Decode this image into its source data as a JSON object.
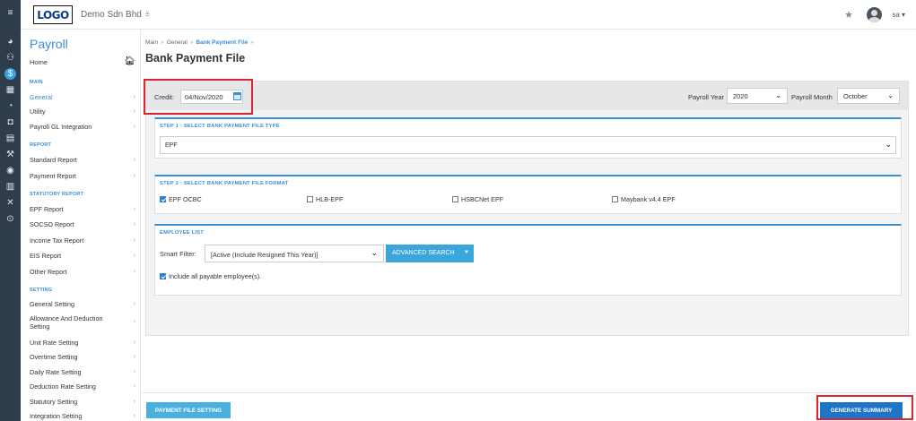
{
  "header": {
    "logo_text": "LOGO",
    "company": "Demo Sdn Bhd",
    "company_chevron": "≚",
    "favorite_icon": "★",
    "user": "sa ▾"
  },
  "rail": {
    "icons": [
      "≡",
      "◕",
      "⚇",
      "$",
      "▦",
      "◔",
      "◘",
      "▤",
      "⚒",
      "◉",
      "▥",
      "✕",
      "⊙"
    ]
  },
  "sidebar": {
    "title": "Payroll",
    "home": "Home",
    "sections": {
      "main": "MAIN",
      "report": "REPORT",
      "statutory": "STATUTORY REPORT",
      "setting": "SETTING"
    },
    "main_items": [
      "General",
      "Utility",
      "Payroll GL Integration"
    ],
    "report_items": [
      "Standard Report",
      "Payment Report"
    ],
    "statutory_items": [
      "EPF Report",
      "SOCSO Report",
      "Income Tax Report",
      "EIS Report",
      "Other Report"
    ],
    "setting_items": [
      "General Setting",
      "Allowance And Deduction Setting",
      "Unit Rate Setting",
      "Overtime Setting",
      "Daily Rate Setting",
      "Deduction Rate Setting",
      "Statutory Setting",
      "Integration Setting"
    ],
    "arrow": "›"
  },
  "breadcrumb": {
    "main": "Main",
    "general": "General",
    "current": "Bank Payment File",
    "sep": "»"
  },
  "page_title": "Bank Payment File",
  "credit": {
    "label": "Credit:",
    "value": "04/Nov/2020"
  },
  "payroll_year": {
    "label": "Payroll Year",
    "value": "2020"
  },
  "payroll_month": {
    "label": "Payroll Month",
    "value": "October"
  },
  "step1": {
    "heading": "STEP 1 : SELECT BANK PAYMENT FILE TYPE",
    "value": "EPF"
  },
  "step2": {
    "heading": "STEP 2 : SELECT BANK PAYMENT FILE FORMAT",
    "options": [
      {
        "label": "EPF OCBC",
        "checked": true
      },
      {
        "label": "HLB-EPF",
        "checked": false
      },
      {
        "label": "HSBCNet EPF",
        "checked": false
      },
      {
        "label": "Maybank v4.4 EPF",
        "checked": false
      }
    ]
  },
  "employee_list": {
    "heading": "EMPLOYEE LIST",
    "smart_filter_label": "Smart Filter:",
    "smart_filter_value": "[Active (Include Resigned This Year)]",
    "advanced_search": "ADVANCED SEARCH",
    "include_all": "Include all payable employee(s)."
  },
  "footer": {
    "payment_file_setting": "PAYMENT FILE SETTING",
    "generate_summary": "GENERATE SUMMARY"
  },
  "colors": {
    "accent": "#3a8fd6",
    "rail_bg": "#2f3c4a",
    "highlight_red": "#d9262c",
    "primary_button": "#1d74c9"
  }
}
